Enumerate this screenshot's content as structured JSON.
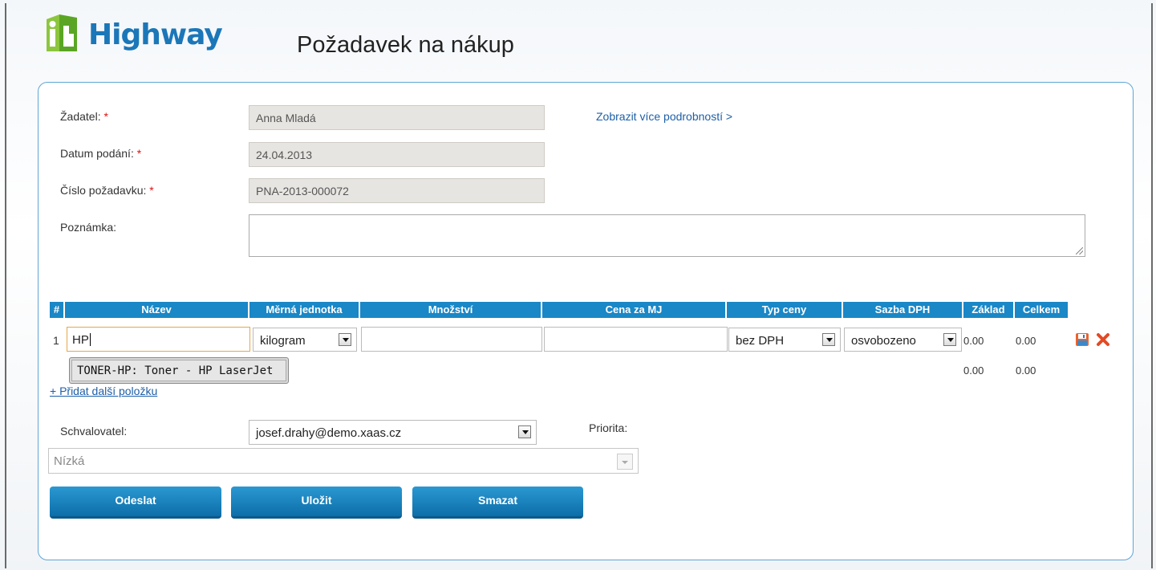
{
  "app": {
    "logo_text": "Highway",
    "page_title": "Požadavek na nákup"
  },
  "colors": {
    "accent": "#1a87c6",
    "link": "#1d5fa7",
    "required": "#dd1111"
  },
  "form": {
    "applicant": {
      "label": "Žadatel:",
      "required": "*",
      "value": "Anna Mladá"
    },
    "submit_date": {
      "label": "Datum podání:",
      "required": "*",
      "value": "24.04.2013"
    },
    "request_number": {
      "label": "Číslo požadavku:",
      "required": "*",
      "value": "PNA-2013-000072"
    },
    "note": {
      "label": "Poznámka:",
      "value": ""
    },
    "details_link": "Zobrazit více podrobností >"
  },
  "items_table": {
    "columns": [
      "#",
      "Název",
      "Měrná jednotka",
      "Množství",
      "Cena za MJ",
      "Typ ceny",
      "Sazba DPH",
      "Základ",
      "Celkem"
    ],
    "rows": [
      {
        "index": "1",
        "name": "HP",
        "unit": "kilogram",
        "quantity": "",
        "unit_price": "",
        "price_type": "bez DPH",
        "vat_rate": "osvobozeno",
        "base": "0.00",
        "total": "0.00"
      }
    ],
    "totals": {
      "base": "0.00",
      "total": "0.00"
    },
    "autocomplete_suggestion": "TONER-HP: Toner - HP LaserJet",
    "add_item_link": "+ Přidat další položku",
    "row_icons": [
      "save-icon",
      "delete-icon"
    ]
  },
  "approval": {
    "approver_label": "Schvalovatel:",
    "approver_value": "josef.drahy@demo.xaas.cz",
    "priority_label": "Priorita:",
    "priority_value": "Nízká"
  },
  "buttons": {
    "send": "Odeslat",
    "save": "Uložit",
    "delete": "Smazat"
  }
}
